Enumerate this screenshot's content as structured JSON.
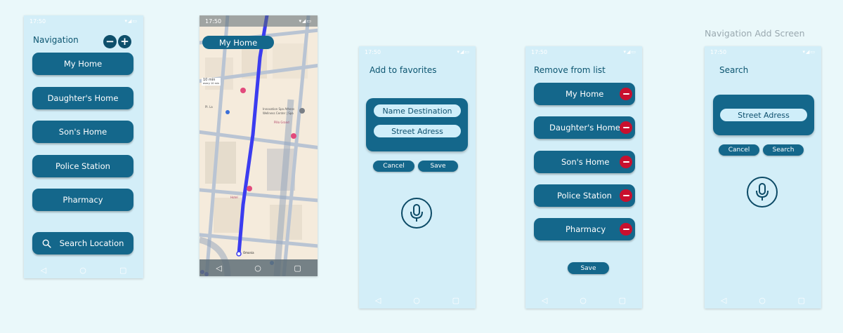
{
  "status": {
    "time": "17:50",
    "icons": "▾◢▭"
  },
  "caption": "Navigation Add Screen",
  "screen1": {
    "title": "Navigation",
    "destinations": [
      "My Home",
      "Daughter's Home",
      "Son's Home",
      "Police Station",
      "Pharmacy"
    ],
    "search_label": "Search Location"
  },
  "screen2": {
    "active_destination": "My Home",
    "map_labels": [
      "10 min",
      "every 10 min",
      "Pl. La",
      "Innovation Spa Athens",
      "Wellness Center | Spa",
      "Pillo Grand",
      "Hotel",
      "Omonia"
    ]
  },
  "screen3": {
    "title": "Add to favorites",
    "name_field": "Name Destination",
    "address_field": "Street Adress",
    "cancel_label": "Cancel",
    "save_label": "Save"
  },
  "screen4": {
    "title": "Remove from list",
    "items": [
      "My Home",
      "Daughter's Home",
      "Son's Home",
      "Police Station",
      "Pharmacy"
    ],
    "save_label": "Save"
  },
  "screen5": {
    "title": "Search",
    "address_field": "Street Adress",
    "cancel_label": "Cancel",
    "search_label": "Search"
  },
  "nav": {
    "back": "◁",
    "home": "○",
    "recent": "▢"
  },
  "colors": {
    "button": "#14678b",
    "phone_bg": "#d3eef8",
    "page_bg": "#eaf8fa",
    "remove_red": "#c8102e",
    "route_blue": "#3b3cf0"
  },
  "icons": [
    "minus-icon",
    "plus-icon",
    "search-icon",
    "microphone-icon",
    "location-pin-icon",
    "back-icon",
    "home-icon",
    "recents-icon"
  ]
}
